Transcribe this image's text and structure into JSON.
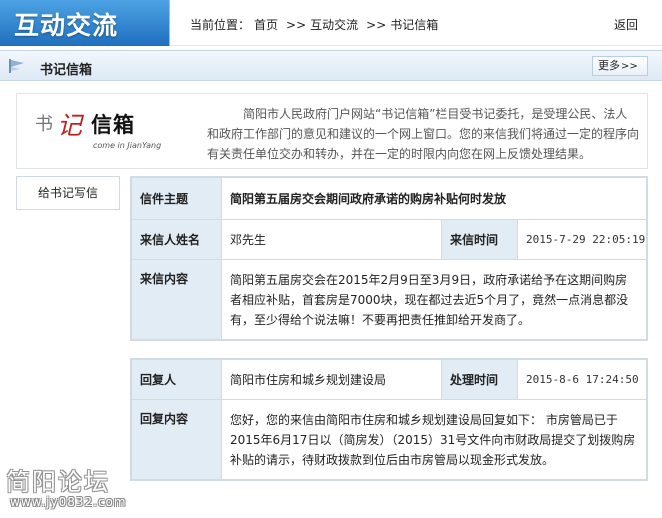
{
  "header": {
    "logo_text": "互动交流",
    "breadcrumb": {
      "prefix": "当前位置：",
      "items": [
        "首页",
        "互动交流",
        "书记信箱"
      ],
      "separator": ">>"
    },
    "back_label": "返回"
  },
  "section": {
    "title": "书记信箱",
    "more_label": "更多",
    "more_arrows": ">>",
    "icon": "flag-icon"
  },
  "intro": {
    "brand": {
      "char1": "书",
      "char2": "记",
      "char3": "信箱",
      "subtitle": "come in JianYang"
    },
    "text": "简阳市人民政府门户网站“书记信箱”栏目受书记委托，是受理公民、法人和政府工作部门的意见和建议的一个网上窗口。您的来信我们将通过一定的程序向有关责任单位交办和转办，并在一定的时限内向您在网上反馈处理结果。"
  },
  "sidebar": {
    "write_button": "给书记写信"
  },
  "letter": {
    "subject_label": "信件主题",
    "subject": "简阳第五届房交会期间政府承诺的购房补贴何时发放",
    "sender_label": "来信人姓名",
    "sender": "邓先生",
    "time_label": "来信时间",
    "time": "2015-7-29 22:05:19",
    "content_label": "来信内容",
    "content": "简阳第五届房交会在2015年2月9日至3月9日，政府承诺给予在这期间购房者相应补贴，首套房是7000块，现在都过去近5个月了，竟然一点消息都没有，至少得给个说法嘛！不要再把责任推卸给开发商了。"
  },
  "reply": {
    "replier_label": "回复人",
    "replier": "简阳市住房和城乡规划建设局",
    "time_label": "处理时间",
    "time": "2015-8-6 17:24:50",
    "content_label": "回复内容",
    "content": "您好，您的来信由简阳市住房和城乡规划建设局回复如下： 市房管局已于2015年6月17日以（简房发）（2015）31号文件向市财政局提交了划拨购房补贴的请示，待财政拨款到位后由市房管局以现金形式发放。"
  },
  "watermark": {
    "title": "简阳论坛",
    "url": "www.jy0832.com"
  }
}
